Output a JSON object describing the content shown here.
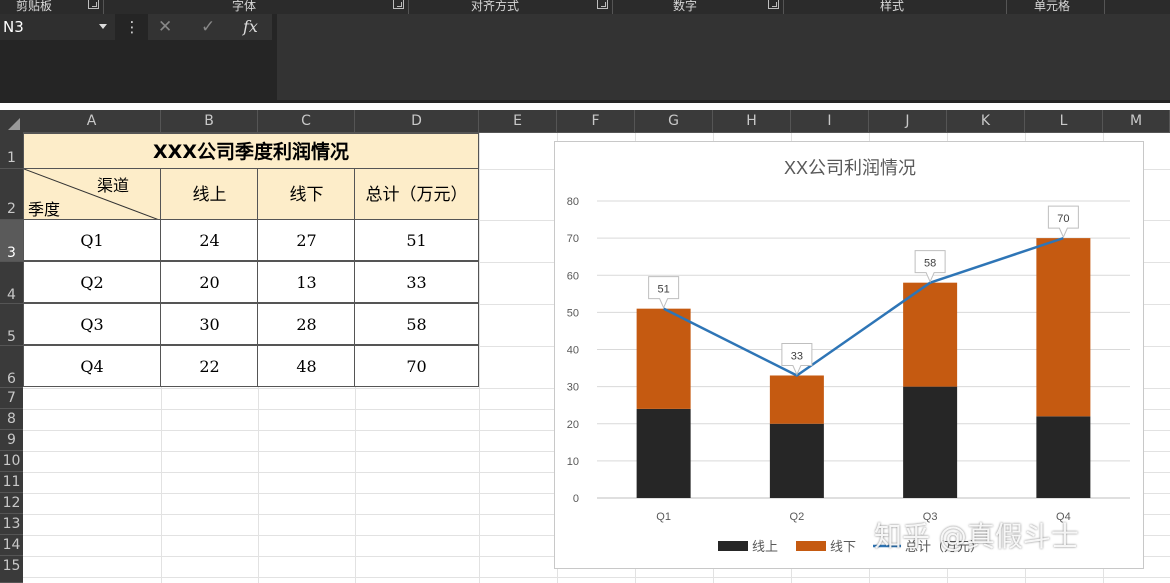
{
  "ribbon": {
    "groups": [
      "剪贴板",
      "字体",
      "对齐方式",
      "数字",
      "样式",
      "单元格"
    ]
  },
  "formula_bar": {
    "name_box": "N3",
    "more_icon": "⋮",
    "cancel_icon": "✕",
    "enter_icon": "✓",
    "fx_label": "fx",
    "formula": ""
  },
  "columns": [
    "A",
    "B",
    "C",
    "D",
    "E",
    "F",
    "G",
    "H",
    "I",
    "J",
    "K",
    "L",
    "M"
  ],
  "rows": [
    "1",
    "2",
    "3",
    "4",
    "5",
    "6",
    "7",
    "8",
    "9",
    "10",
    "11",
    "12",
    "13",
    "14",
    "15"
  ],
  "active_row": "3",
  "table": {
    "title": "XXX公司季度利润情况",
    "header_channel": "渠道",
    "header_season": "季度",
    "headers": [
      "线上",
      "线下",
      "总计（万元）"
    ],
    "rows": [
      [
        "Q1",
        "24",
        "27",
        "51"
      ],
      [
        "Q2",
        "20",
        "13",
        "33"
      ],
      [
        "Q3",
        "30",
        "28",
        "58"
      ],
      [
        "Q4",
        "22",
        "48",
        "70"
      ]
    ],
    "title_bg": "#fdedc9"
  },
  "chart_data": {
    "type": "bar",
    "stacked": true,
    "title": "XX公司利润情况",
    "categories": [
      "Q1",
      "Q2",
      "Q3",
      "Q4"
    ],
    "series": [
      {
        "name": "线上",
        "kind": "bar",
        "color": "#262626",
        "values": [
          24,
          20,
          30,
          22
        ]
      },
      {
        "name": "线下",
        "kind": "bar",
        "color": "#c55a11",
        "values": [
          27,
          13,
          28,
          48
        ]
      },
      {
        "name": "总计（万元）",
        "kind": "line",
        "color": "#2e75b6",
        "values": [
          51,
          33,
          58,
          70
        ],
        "data_labels": [
          "51",
          "33",
          "58",
          "70"
        ]
      }
    ],
    "ylim": [
      0,
      80
    ],
    "yticks": [
      "0",
      "10",
      "20",
      "30",
      "40",
      "50",
      "60",
      "70",
      "80"
    ],
    "grid": true,
    "legend": "bottom",
    "legend_labels": [
      "线上",
      "线下",
      "总计（万元）"
    ]
  },
  "watermark": "知乎 @真假斗士"
}
